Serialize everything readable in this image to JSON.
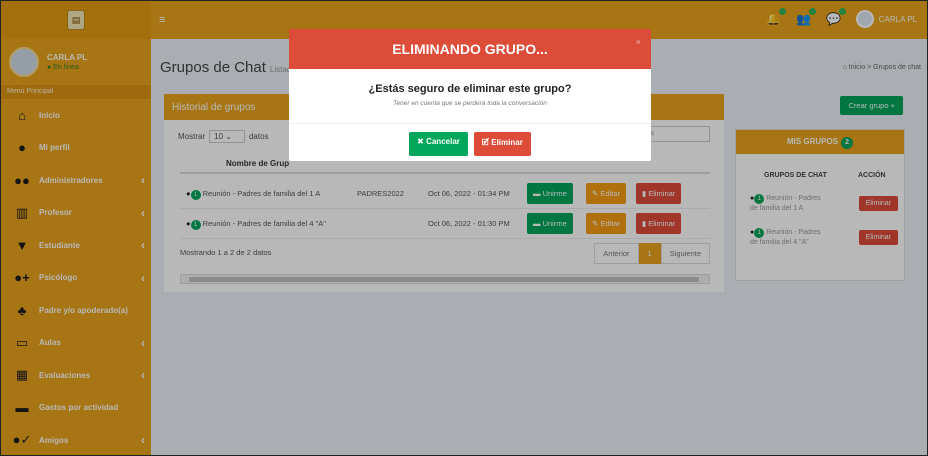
{
  "header": {
    "user_name": "CARLA PL",
    "menu_icon": "hamburger-icon"
  },
  "sidebar": {
    "user_name": "CARLA PL",
    "status": "● En línea",
    "menu_header": "Menú Principal",
    "items": [
      {
        "label": "Inicio",
        "icon": "home-icon",
        "has_children": false
      },
      {
        "label": "Mi perfil",
        "icon": "user-icon",
        "has_children": false
      },
      {
        "label": "Administradores",
        "icon": "users-icon",
        "has_children": true
      },
      {
        "label": "Profesor",
        "icon": "building-icon",
        "has_children": true
      },
      {
        "label": "Estudiante",
        "icon": "student-icon",
        "has_children": true
      },
      {
        "label": "Psicólogo",
        "icon": "user-md-icon",
        "has_children": true
      },
      {
        "label": "Padre y/o apoderado(a)",
        "icon": "family-icon",
        "has_children": false
      },
      {
        "label": "Aulas",
        "icon": "classroom-icon",
        "has_children": true
      },
      {
        "label": "Evaluaciones",
        "icon": "evaluation-icon",
        "has_children": true
      },
      {
        "label": "Gastos por actividad",
        "icon": "money-icon",
        "has_children": false
      },
      {
        "label": "Amigos",
        "icon": "friends-icon",
        "has_children": true
      }
    ]
  },
  "page": {
    "title": "Grupos de Chat",
    "subtitle": "Listado",
    "breadcrumb_home": "Inicio",
    "breadcrumb_sep": ">",
    "breadcrumb_current": "Grupos de chat"
  },
  "main_box": {
    "title": "Historial de grupos",
    "show_label": "Mostrar",
    "show_value": "10",
    "show_suffix": "datos",
    "search_placeholder": "datos",
    "column_name": "Nombre de Grup",
    "rows": [
      {
        "name": "Reunión - Padres de familia del 1 A",
        "code": "PADRES2022",
        "date": "Oct 06, 2022 - 01:34 PM",
        "join": "Unirme",
        "edit": "Editar",
        "delete": "Eliminar"
      },
      {
        "name": "Reunión - Padres de familia del 4 \"A\"",
        "code": "",
        "date": "Oct 06, 2022 - 01:30 PM",
        "join": "Unirme",
        "edit": "Editar",
        "delete": "Eliminar"
      }
    ],
    "info": "Mostrando 1 a 2 de 2 datos",
    "pager": {
      "prev": "Anterior",
      "current": "1",
      "next": "Siguiente"
    }
  },
  "create_button": "Crear grupo",
  "side_box": {
    "title": "MIS GRUPOS",
    "count": "2",
    "col_chat": "GRUPOS DE CHAT",
    "col_action": "ACCIÓN",
    "rows": [
      {
        "name": "Reunión - Padres de familia del 1 A",
        "action": "Eliminar"
      },
      {
        "name": "Reunión - Padres de familia del 4 \"A\"",
        "action": "Eliminar"
      }
    ]
  },
  "modal": {
    "title": "ELIMINANDO GRUPO...",
    "close": "×",
    "question": "¿Estás seguro de eliminar este grupo?",
    "note": "Tener en cuenta que se perderá toda la conversación",
    "cancel": "✖ Cancelar",
    "confirm": "🗹 Eliminar",
    "colors": {
      "header": "#dd4b39",
      "cancel": "#00a65a",
      "confirm": "#dd4b39"
    }
  },
  "colors": {
    "brand": "#e8a21b",
    "success": "#00a65a",
    "danger": "#dd4b39",
    "warning": "#f39c12"
  }
}
